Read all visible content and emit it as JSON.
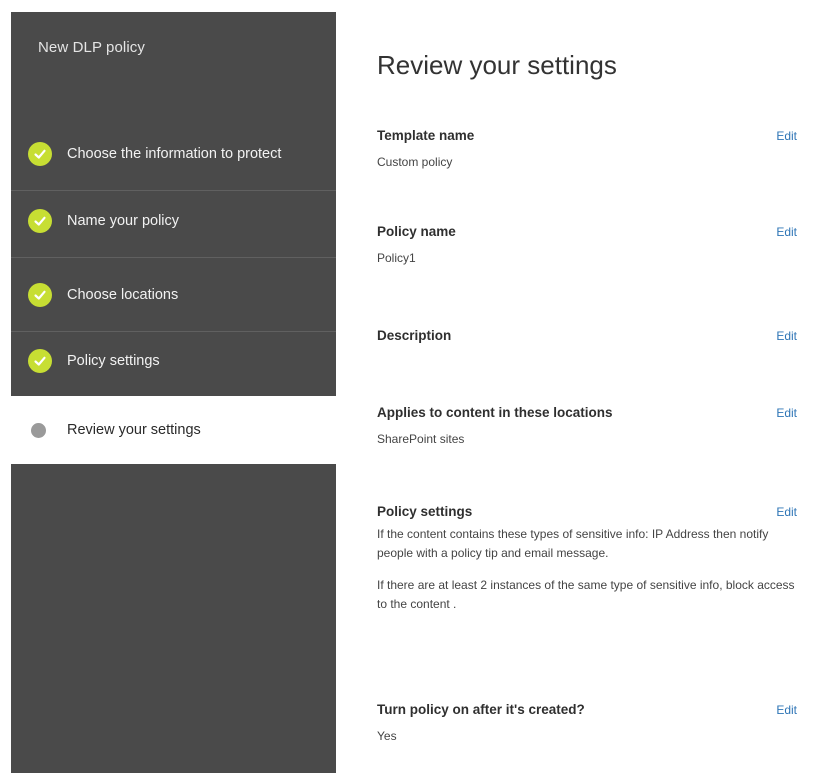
{
  "wizard": {
    "title": "New DLP policy",
    "steps": [
      {
        "label": "Choose the information to protect",
        "status": "done"
      },
      {
        "label": "Name your policy",
        "status": "done"
      },
      {
        "label": "Choose locations",
        "status": "done"
      },
      {
        "label": "Policy settings",
        "status": "done"
      },
      {
        "label": "Review your settings",
        "status": "current"
      }
    ],
    "colors": {
      "panel": "#4a4a4a",
      "check": "#c7de33",
      "current_dot": "#9a9a9a"
    }
  },
  "review": {
    "title": "Review your settings",
    "edit_label": "Edit",
    "sections": [
      {
        "heading": "Template name",
        "value": "Custom policy"
      },
      {
        "heading": "Policy name",
        "value": "Policy1"
      },
      {
        "heading": "Description",
        "value": ""
      },
      {
        "heading": "Applies to content in these locations",
        "value": "SharePoint sites"
      },
      {
        "heading": "Policy settings",
        "value": "If the content contains these types of sensitive info: IP Address then notify people with a policy tip and email message.",
        "value2": "If there are at least 2 instances of the same type of sensitive info, block access to the content ."
      },
      {
        "heading": "Turn policy on after it's created?",
        "value": "Yes"
      }
    ],
    "colors": {
      "link": "#2e75b6"
    }
  }
}
